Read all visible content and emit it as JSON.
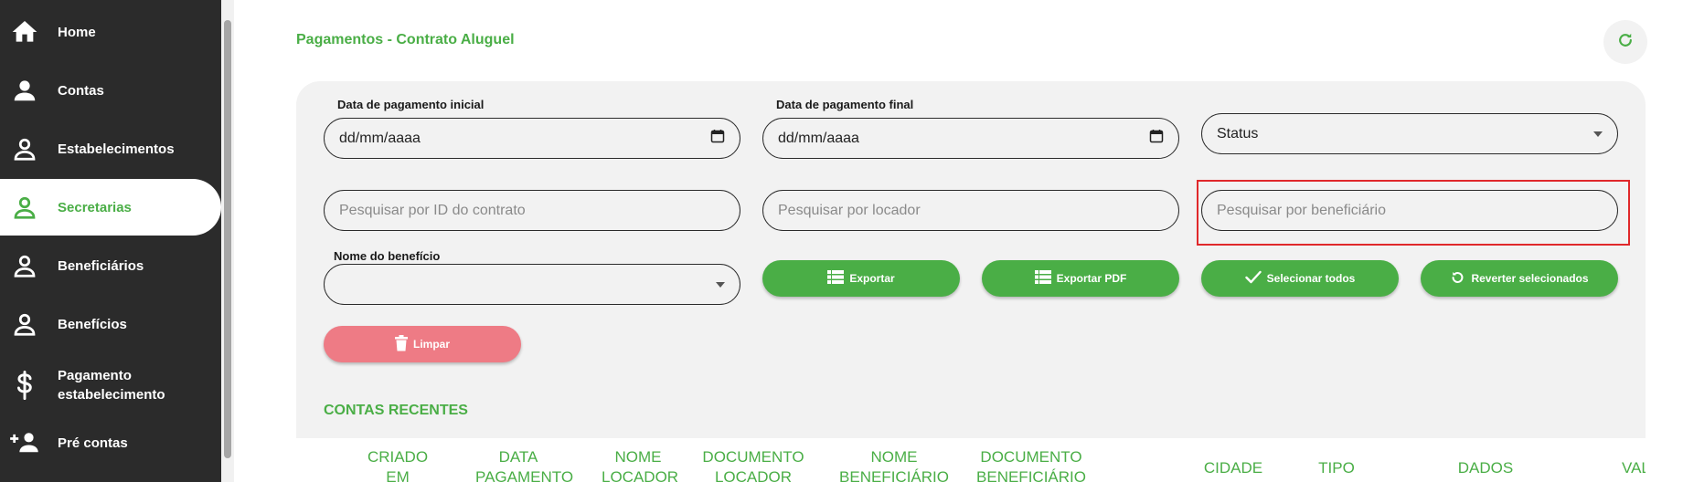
{
  "sidebar": {
    "items": [
      {
        "label": "Home",
        "icon": "home-icon",
        "active": false
      },
      {
        "label": "Contas",
        "icon": "user-icon",
        "active": false
      },
      {
        "label": "Estabelecimentos",
        "icon": "user-outline-icon",
        "active": false
      },
      {
        "label": "Secretarias",
        "icon": "user-outline-icon",
        "active": true
      },
      {
        "label": "Beneficiários",
        "icon": "user-outline-icon",
        "active": false
      },
      {
        "label": "Benefícios",
        "icon": "user-outline-icon",
        "active": false
      },
      {
        "label": "Pagamento estabelecimento",
        "icon": "dollar-icon",
        "active": false
      },
      {
        "label": "Pré contas",
        "icon": "user-plus-icon",
        "active": false
      }
    ]
  },
  "header": {
    "title": "Pagamentos - Contrato Aluguel",
    "refresh_icon": "refresh-icon"
  },
  "filters": {
    "start_date_label": "Data de pagamento inicial",
    "start_date_value": "dd/mm/aaaa",
    "end_date_label": "Data de pagamento final",
    "end_date_value": "dd/mm/aaaa",
    "status_value": "Status",
    "contract_id_placeholder": "Pesquisar por ID do contrato",
    "landlord_placeholder": "Pesquisar por locador",
    "beneficiary_placeholder": "Pesquisar por beneficiário",
    "benefit_name_label": "Nome do benefício",
    "benefit_name_value": ""
  },
  "actions": {
    "export_label": "Exportar",
    "export_pdf_label": "Exportar PDF",
    "select_all_label": "Selecionar todos",
    "revert_selected_label": "Reverter selecionados",
    "clear_label": "Limpar"
  },
  "table": {
    "section_title": "CONTAS RECENTES",
    "columns": [
      "CRIADO EM",
      "DATA PAGAMENTO",
      "NOME LOCADOR",
      "DOCUMENTO LOCADOR",
      "NOME BENEFICIÁRIO",
      "DOCUMENTO BENEFICIÁRIO",
      "CIDADE",
      "TIPO",
      "DADOS",
      "VAL"
    ]
  },
  "colors": {
    "accent": "#4aae46",
    "sidebar_bg": "#2b2b2b",
    "danger": "#ee7b85",
    "highlight": "#e0282b",
    "panel_bg": "#f2f2f2"
  }
}
